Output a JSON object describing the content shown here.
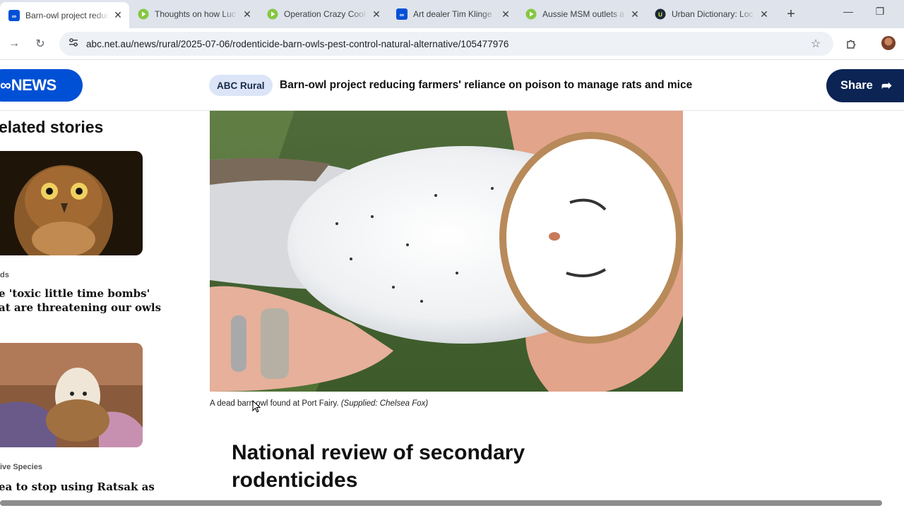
{
  "browser": {
    "tabs": [
      {
        "title": "Barn-owl project reducing",
        "favicon": "abc-icon",
        "active": true
      },
      {
        "title": "Thoughts on how Luc",
        "favicon": "rumble-icon",
        "active": false
      },
      {
        "title": "Operation Crazy Cool",
        "favicon": "rumble-icon",
        "active": false
      },
      {
        "title": "Art dealer Tim Klinge",
        "favicon": "abc-icon",
        "active": false
      },
      {
        "title": "Aussie MSM outlets a",
        "favicon": "rumble-icon",
        "active": false
      },
      {
        "title": "Urban Dictionary: Loc",
        "favicon": "urban-dictionary-icon",
        "active": false
      }
    ],
    "url": "abc.net.au/news/rural/2025-07-06/rodenticide-barn-owls-pest-control-natural-alternative/105477976"
  },
  "header": {
    "logo_mark": "ABC",
    "logo_text": "NEWS",
    "section": "ABC Rural",
    "title": "Barn-owl project reducing farmers' reliance on poison to manage rats and mice",
    "share_label": "Share"
  },
  "related": {
    "heading": "elated stories",
    "stories": [
      {
        "kicker": "ds",
        "title_line1": "e 'toxic little time bombs'",
        "title_line2": "at are threatening our owls"
      },
      {
        "kicker": "ive Species",
        "title_line1": "ea to stop using Ratsak as"
      }
    ]
  },
  "article": {
    "caption": "A dead barn owl found at Port Fairy.",
    "caption_credit": "(Supplied: Chelsea Fox)",
    "subheading": "National review of secondary rodenticides"
  },
  "colors": {
    "abc_blue": "#0050d6",
    "share_navy": "#0b2454",
    "pill_bg": "#dbe5f7",
    "rumble_green": "#85c742"
  }
}
